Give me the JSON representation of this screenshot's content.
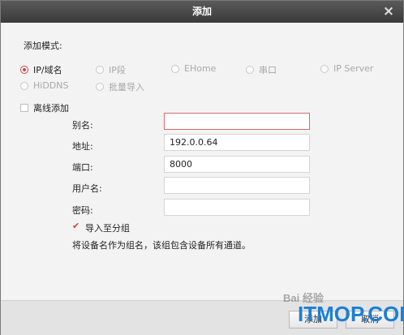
{
  "window": {
    "title": "添加",
    "close_glyph": "×"
  },
  "add_mode": {
    "label": "添加模式:",
    "options": [
      {
        "label": "IP/域名",
        "selected": true,
        "enabled": true
      },
      {
        "label": "IP段",
        "selected": false,
        "enabled": false
      },
      {
        "label": "EHome",
        "selected": false,
        "enabled": false
      },
      {
        "label": "串口",
        "selected": false,
        "enabled": false
      },
      {
        "label": "IP Server",
        "selected": false,
        "enabled": false
      },
      {
        "label": "HiDDNS",
        "selected": false,
        "enabled": false
      },
      {
        "label": "批量导入",
        "selected": false,
        "enabled": false
      }
    ]
  },
  "offline_add": {
    "label": "离线添加",
    "checked": false
  },
  "form": {
    "alias": {
      "label": "别名:",
      "value": ""
    },
    "address": {
      "label": "地址:",
      "value": "192.0.0.64"
    },
    "port": {
      "label": "端口:",
      "value": "8000"
    },
    "username": {
      "label": "用户名:",
      "value": ""
    },
    "password": {
      "label": "密码:",
      "value": ""
    }
  },
  "import_group": {
    "label": "导入至分组",
    "checked": true
  },
  "note": "将设备名作为组名，该组包含设备所有通道。",
  "buttons": {
    "add": "添加",
    "cancel": "取消"
  },
  "watermark": {
    "logo": "Bai 经验",
    "site": "ITMOP.COM"
  },
  "colors": {
    "accent": "#d04040",
    "titlebar": "#4a4a4a",
    "watermark": "#1b7fd4"
  }
}
